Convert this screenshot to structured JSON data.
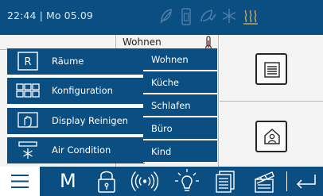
{
  "status": {
    "time": "22:44 | Mo 05.09"
  },
  "room": {
    "name": "Wohnen"
  },
  "menu": {
    "items": [
      {
        "label": "Räume",
        "icon": "letter-r-icon",
        "letter": "R"
      },
      {
        "label": "Konfiguration",
        "icon": "grid-icon"
      },
      {
        "label": "Display Reinigen",
        "icon": "hand-cleaning-icon"
      },
      {
        "label": "Air Condition",
        "icon": "air-condition-icon"
      }
    ]
  },
  "rooms": {
    "items": [
      {
        "label": "Wohnen"
      },
      {
        "label": "Küche"
      },
      {
        "label": "Schlafen"
      },
      {
        "label": "Büro"
      },
      {
        "label": "Kind"
      }
    ]
  },
  "bottom": {
    "m_label": "M"
  },
  "colors": {
    "primary": "#0b4e82",
    "background": "#f3f3f3",
    "text_light": "#d9e6f2"
  }
}
